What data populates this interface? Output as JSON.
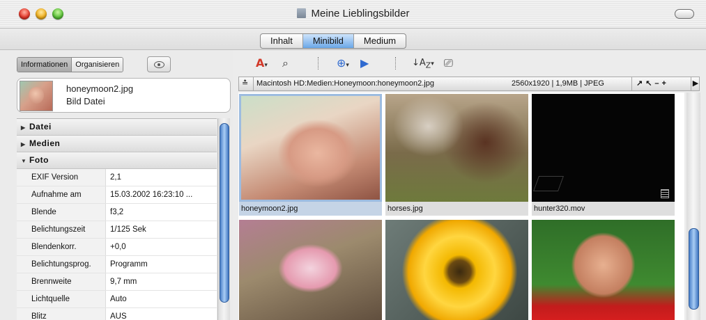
{
  "window": {
    "title": "Meine Lieblingsbilder"
  },
  "view_tabs": [
    "Inhalt",
    "Minibild",
    "Medium"
  ],
  "active_view": "Minibild",
  "panel_tabs": {
    "info": "Informationen",
    "organize": "Organisieren"
  },
  "file": {
    "name": "honeymoon2.jpg",
    "type": "Bild Datei"
  },
  "sections": {
    "datei": "Datei",
    "medien": "Medien",
    "foto": "Foto"
  },
  "exif": [
    {
      "key": "EXIF Version",
      "value": "2,1"
    },
    {
      "key": "Aufnahme am",
      "value": "15.03.2002 16:23:10 ..."
    },
    {
      "key": "Blende",
      "value": "f3,2"
    },
    {
      "key": "Belichtungszeit",
      "value": "1/125 Sek"
    },
    {
      "key": "Blendenkorr.",
      "value": "+0,0"
    },
    {
      "key": "Belichtungsprog.",
      "value": "Programm"
    },
    {
      "key": "Brennweite",
      "value": "9,7 mm"
    },
    {
      "key": "Lichtquelle",
      "value": "Auto"
    },
    {
      "key": "Blitz",
      "value": "AUS"
    }
  ],
  "pathbar": {
    "path": "Macintosh HD:Medien:Honeymoon:honeymoon2.jpg",
    "meta": "2560x1920 | 1,9MB | JPEG",
    "controls": "↗↖–+",
    "arrow": "▶"
  },
  "thumbnails": [
    {
      "caption": "honeymoon2.jpg",
      "selected": true
    },
    {
      "caption": "horses.jpg"
    },
    {
      "caption": "hunter320.mov"
    },
    {
      "caption": ""
    },
    {
      "caption": ""
    },
    {
      "caption": ""
    }
  ],
  "colors": {
    "selection": "#9dbce0",
    "scroll_thumb": "#5b8fd6"
  }
}
